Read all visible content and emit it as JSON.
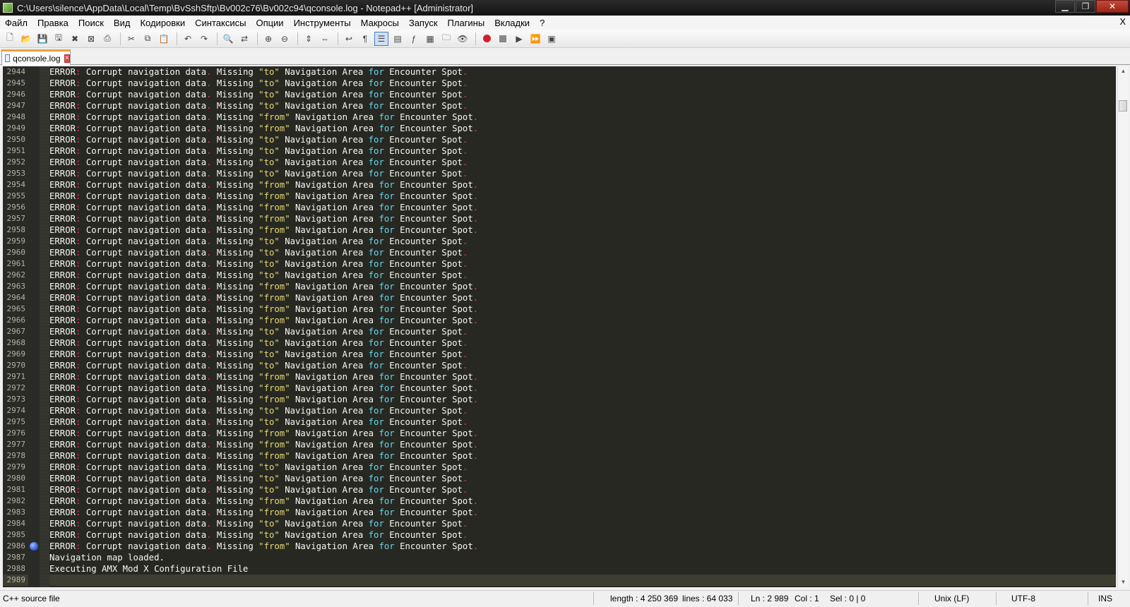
{
  "window": {
    "title": "C:\\Users\\silence\\AppData\\Local\\Temp\\BvSshSftp\\Bv002c76\\Bv002c94\\qconsole.log - Notepad++ [Administrator]",
    "minimize": "▁",
    "maximize": "❐",
    "close": "✕"
  },
  "menu": {
    "items": [
      "Файл",
      "Правка",
      "Поиск",
      "Вид",
      "Кодировки",
      "Синтаксисы",
      "Опции",
      "Инструменты",
      "Макросы",
      "Запуск",
      "Плагины",
      "Вкладки",
      "?"
    ],
    "close": "X"
  },
  "toolbar": {
    "buttons": [
      {
        "name": "new-file-icon",
        "glyph": "🗋"
      },
      {
        "name": "open-file-icon",
        "glyph": "📂"
      },
      {
        "name": "save-icon",
        "glyph": "💾"
      },
      {
        "name": "save-all-icon",
        "glyph": "🖫"
      },
      {
        "name": "close-file-icon",
        "glyph": "✖"
      },
      {
        "name": "close-all-icon",
        "glyph": "⊠"
      },
      {
        "name": "print-icon",
        "glyph": "⎙"
      },
      {
        "sep": true
      },
      {
        "name": "cut-icon",
        "glyph": "✂"
      },
      {
        "name": "copy-icon",
        "glyph": "⧉"
      },
      {
        "name": "paste-icon",
        "glyph": "📋"
      },
      {
        "sep": true
      },
      {
        "name": "undo-icon",
        "glyph": "↶"
      },
      {
        "name": "redo-icon",
        "glyph": "↷"
      },
      {
        "sep": true
      },
      {
        "name": "find-icon",
        "glyph": "🔍"
      },
      {
        "name": "replace-icon",
        "glyph": "⇄"
      },
      {
        "sep": true
      },
      {
        "name": "zoom-in-icon",
        "glyph": "⊕"
      },
      {
        "name": "zoom-out-icon",
        "glyph": "⊖"
      },
      {
        "sep": true
      },
      {
        "name": "sync-vertical-icon",
        "glyph": "⇕"
      },
      {
        "name": "sync-horizontal-icon",
        "glyph": "⇔"
      },
      {
        "sep": true
      },
      {
        "name": "word-wrap-icon",
        "glyph": "↩"
      },
      {
        "name": "show-all-chars-icon",
        "glyph": "¶"
      },
      {
        "name": "indent-guide-icon",
        "glyph": "☰",
        "active": true
      },
      {
        "name": "user-language-icon",
        "glyph": "▤"
      },
      {
        "name": "function-list-icon",
        "glyph": "ƒ"
      },
      {
        "name": "doc-map-icon",
        "glyph": "▦"
      },
      {
        "name": "folder-workspace-icon",
        "glyph": "🗀"
      },
      {
        "name": "monitoring-icon",
        "glyph": "👁"
      },
      {
        "sep": true
      },
      {
        "name": "record-macro-icon",
        "glyph": "rec"
      },
      {
        "name": "stop-macro-icon",
        "glyph": "stop"
      },
      {
        "name": "play-macro-icon",
        "glyph": "▶"
      },
      {
        "name": "run-macro-multiple-icon",
        "glyph": "⏩"
      },
      {
        "name": "save-macro-icon",
        "glyph": "▣"
      }
    ]
  },
  "tab": {
    "label": "qconsole.log",
    "close": "×"
  },
  "editor": {
    "colors": {
      "background": "#272822",
      "error": "#f92672",
      "keyword": "#66d9ef",
      "string": "#e6db74",
      "text": "#f8f8f2"
    },
    "current_line_number": "2989",
    "bookmark_line_number": "2986",
    "lines": [
      {
        "n": "2944",
        "kind": "to"
      },
      {
        "n": "2945",
        "kind": "to"
      },
      {
        "n": "2946",
        "kind": "to"
      },
      {
        "n": "2947",
        "kind": "to"
      },
      {
        "n": "2948",
        "kind": "from"
      },
      {
        "n": "2949",
        "kind": "from"
      },
      {
        "n": "2950",
        "kind": "to"
      },
      {
        "n": "2951",
        "kind": "to"
      },
      {
        "n": "2952",
        "kind": "to"
      },
      {
        "n": "2953",
        "kind": "to"
      },
      {
        "n": "2954",
        "kind": "from"
      },
      {
        "n": "2955",
        "kind": "from"
      },
      {
        "n": "2956",
        "kind": "from"
      },
      {
        "n": "2957",
        "kind": "from"
      },
      {
        "n": "2958",
        "kind": "from"
      },
      {
        "n": "2959",
        "kind": "to"
      },
      {
        "n": "2960",
        "kind": "to"
      },
      {
        "n": "2961",
        "kind": "to"
      },
      {
        "n": "2962",
        "kind": "to"
      },
      {
        "n": "2963",
        "kind": "from"
      },
      {
        "n": "2964",
        "kind": "from"
      },
      {
        "n": "2965",
        "kind": "from"
      },
      {
        "n": "2966",
        "kind": "from"
      },
      {
        "n": "2967",
        "kind": "to"
      },
      {
        "n": "2968",
        "kind": "to"
      },
      {
        "n": "2969",
        "kind": "to"
      },
      {
        "n": "2970",
        "kind": "to"
      },
      {
        "n": "2971",
        "kind": "from"
      },
      {
        "n": "2972",
        "kind": "from"
      },
      {
        "n": "2973",
        "kind": "from"
      },
      {
        "n": "2974",
        "kind": "to"
      },
      {
        "n": "2975",
        "kind": "to"
      },
      {
        "n": "2976",
        "kind": "from"
      },
      {
        "n": "2977",
        "kind": "from"
      },
      {
        "n": "2978",
        "kind": "from"
      },
      {
        "n": "2979",
        "kind": "to"
      },
      {
        "n": "2980",
        "kind": "to"
      },
      {
        "n": "2981",
        "kind": "to"
      },
      {
        "n": "2982",
        "kind": "from"
      },
      {
        "n": "2983",
        "kind": "from"
      },
      {
        "n": "2984",
        "kind": "to"
      },
      {
        "n": "2985",
        "kind": "to"
      },
      {
        "n": "2986",
        "kind": "from"
      },
      {
        "n": "2987",
        "kind": "plain",
        "text": "Navigation map loaded."
      },
      {
        "n": "2988",
        "kind": "plain",
        "text": "Executing AMX Mod X Configuration File"
      },
      {
        "n": "2989",
        "kind": "plain",
        "text": ""
      }
    ],
    "error_tokens": {
      "error": "ERROR",
      "colon": ":",
      "part1": " Corrupt navigation data",
      "dot": ".",
      "missing": " Missing ",
      "to_str": "\"to\"",
      "from_str": "\"from\"",
      "nav_area": " Navigation Area ",
      "for_kw": "for",
      "spot": " Encounter Spot"
    }
  },
  "scrollbar": {
    "up": "▲",
    "down": "▼"
  },
  "status": {
    "file_type": "C++ source file",
    "length": "length : 4 250 369",
    "lines": "lines : 64 033",
    "ln": "Ln : 2 989",
    "col": "Col : 1",
    "sel": "Sel : 0 | 0",
    "eol": "Unix (LF)",
    "encoding": "UTF-8",
    "mode": "INS"
  }
}
